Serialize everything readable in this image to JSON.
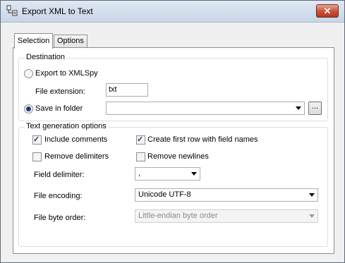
{
  "window": {
    "title": "Export XML to Text",
    "close_glyph": "✕"
  },
  "tabs": [
    {
      "label": "Selection"
    },
    {
      "label": "Options"
    }
  ],
  "destination": {
    "title": "Destination",
    "export_label": "Export to XMLSpy",
    "export_selected": false,
    "file_ext_label": "File extension:",
    "file_ext_value": "txt",
    "save_label": "Save in folder",
    "save_selected": true,
    "folder_value": "",
    "browse_label": "..."
  },
  "options": {
    "title": "Text generation options",
    "include_comments": {
      "label": "Include comments",
      "checked": true
    },
    "create_first_row": {
      "label": "Create first row with field names",
      "checked": true
    },
    "remove_delimiters": {
      "label": "Remove delimiters",
      "checked": false
    },
    "remove_newlines": {
      "label": "Remove newlines",
      "checked": false
    },
    "field_delimiter_label": "Field delimiter:",
    "field_delimiter_value": ",",
    "file_encoding_label": "File encoding:",
    "file_encoding_value": "Unicode UTF-8",
    "byte_order_label": "File byte order:",
    "byte_order_value": "Little-endian byte order"
  },
  "icons": {
    "app": "export-text-icon",
    "close": "close-icon",
    "dropdown": "chevron-down-icon"
  }
}
